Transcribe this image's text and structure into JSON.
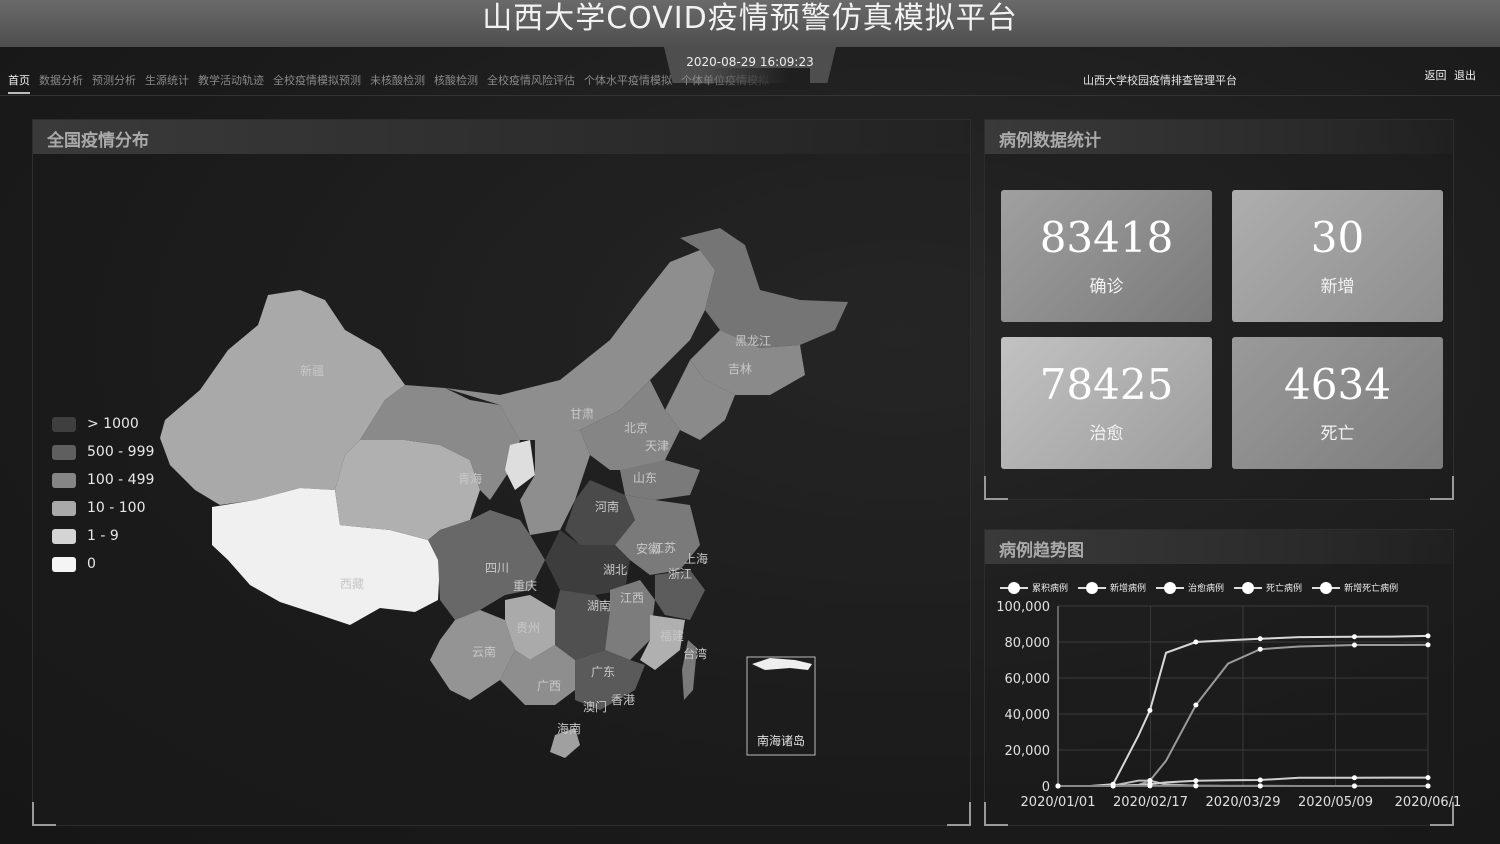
{
  "header": {
    "title": "山西大学COVID疫情预警仿真模拟平台",
    "datetime": "2020-08-29 16:09:23",
    "subtitle": "山西大学校园疫情排查管理平台",
    "back_label": "返回",
    "logout_label": "退出"
  },
  "nav": {
    "items": [
      "首页",
      "数据分析",
      "预测分析",
      "生源统计",
      "教学活动轨迹",
      "全校疫情模拟预测",
      "未核酸检测",
      "核酸检测",
      "全校疫情风险评估",
      "个体水平疫情模拟",
      "个体单位疫情模拟"
    ],
    "active_index": 0
  },
  "map_panel": {
    "title": "全国疫情分布",
    "legend": [
      {
        "label": "> 1000",
        "color": "#3f3f3f"
      },
      {
        "label": "500 - 999",
        "color": "#5f5f5f"
      },
      {
        "label": "100 - 499",
        "color": "#858585"
      },
      {
        "label": "10 - 100",
        "color": "#a9a9a9"
      },
      {
        "label": "1 - 9",
        "color": "#d4d4d4"
      },
      {
        "label": "0",
        "color": "#f4f4f4"
      }
    ],
    "province_labels": [
      "新疆",
      "西藏",
      "青海",
      "四川",
      "重庆",
      "河南",
      "湖北",
      "湖南",
      "江西",
      "安徽",
      "江苏",
      "上海",
      "浙江",
      "山东",
      "北京",
      "天津",
      "黑龙江",
      "吉林",
      "福建",
      "台湾",
      "广东",
      "香港",
      "澳门",
      "海南",
      "贵州",
      "云南",
      "广西",
      "甘肃"
    ],
    "south_sea_label": "南海诸岛"
  },
  "stats_panel": {
    "title": "病例数据统计",
    "cards": [
      {
        "value": "83418",
        "label": "确诊"
      },
      {
        "value": "30",
        "label": "新增"
      },
      {
        "value": "78425",
        "label": "治愈"
      },
      {
        "value": "4634",
        "label": "死亡"
      }
    ]
  },
  "trend_panel": {
    "title": "病例趋势图"
  },
  "chart_data": {
    "type": "line",
    "title": "",
    "xlabel": "",
    "ylabel": "",
    "x_tick_labels": [
      "2020/01/01",
      "2020/02/17",
      "2020/03/29",
      "2020/05/09",
      "2020/06/1"
    ],
    "y_tick_labels": [
      "0",
      "20,000",
      "40,000",
      "60,000",
      "80,000",
      "100,000"
    ],
    "ylim": [
      0,
      100000
    ],
    "x": [
      "2020/01/01",
      "2020/01/15",
      "2020/01/25",
      "2020/02/05",
      "2020/02/10",
      "2020/02/17",
      "2020/03/01",
      "2020/03/15",
      "2020/03/29",
      "2020/04/15",
      "2020/05/09",
      "2020/05/25",
      "2020/06/10"
    ],
    "series": [
      {
        "name": "累积病例",
        "values": [
          0,
          0,
          1000,
          28000,
          42000,
          74000,
          80000,
          81000,
          81800,
          82700,
          82900,
          83000,
          83400
        ]
      },
      {
        "name": "新增病例",
        "values": [
          0,
          0,
          200,
          3000,
          3000,
          800,
          200,
          50,
          60,
          20,
          5,
          10,
          30
        ]
      },
      {
        "name": "治愈病例",
        "values": [
          0,
          0,
          30,
          500,
          3000,
          14000,
          45000,
          68000,
          76000,
          77500,
          78300,
          78300,
          78400
        ]
      },
      {
        "name": "死亡病例",
        "values": [
          0,
          0,
          50,
          600,
          1000,
          2000,
          2900,
          3200,
          3300,
          4600,
          4600,
          4630,
          4634
        ]
      },
      {
        "name": "新增死亡病例",
        "values": [
          0,
          0,
          5,
          60,
          100,
          100,
          40,
          15,
          5,
          5,
          0,
          0,
          0
        ]
      }
    ]
  }
}
